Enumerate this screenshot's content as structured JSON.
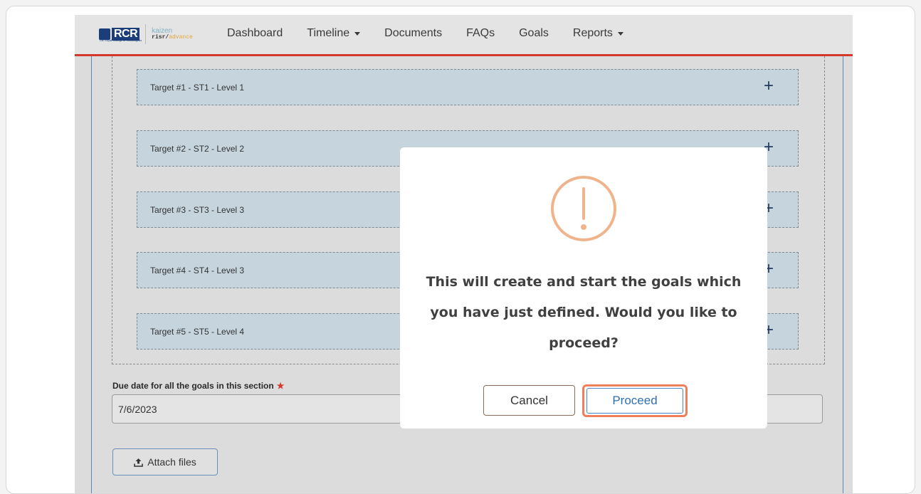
{
  "brand": {
    "logo_text": "RCR",
    "logo_subtitle": "The Royal College of Radiologists",
    "product_top": "kaizen",
    "product_name": "risr/",
    "product_suffix": "advance"
  },
  "nav": {
    "items": [
      {
        "label": "Dashboard",
        "dropdown": false
      },
      {
        "label": "Timeline",
        "dropdown": true
      },
      {
        "label": "Documents",
        "dropdown": false
      },
      {
        "label": "FAQs",
        "dropdown": false
      },
      {
        "label": "Goals",
        "dropdown": false
      },
      {
        "label": "Reports",
        "dropdown": true
      }
    ]
  },
  "targets": [
    {
      "label": "Target #1 - ST1 - Level 1"
    },
    {
      "label": "Target #2 - ST2 - Level 2"
    },
    {
      "label": "Target #3 - ST3 - Level 3"
    },
    {
      "label": "Target #4 - ST4 - Level 3"
    },
    {
      "label": "Target #5 - ST5 - Level 4"
    }
  ],
  "due_date": {
    "label": "Due date for all the goals in this section",
    "required_mark": "★",
    "value": "7/6/2023"
  },
  "attach": {
    "label": "Attach files"
  },
  "modal": {
    "icon": "exclamation-circle-icon",
    "message": "This will create and start the goals which you have just defined. Would you like to proceed?",
    "cancel_label": "Cancel",
    "proceed_label": "Proceed"
  },
  "colors": {
    "accent_red": "#d6372d",
    "warning": "#f0b48d",
    "proceed_highlight": "#ef7f5b",
    "link_blue": "#2f6fb5"
  }
}
